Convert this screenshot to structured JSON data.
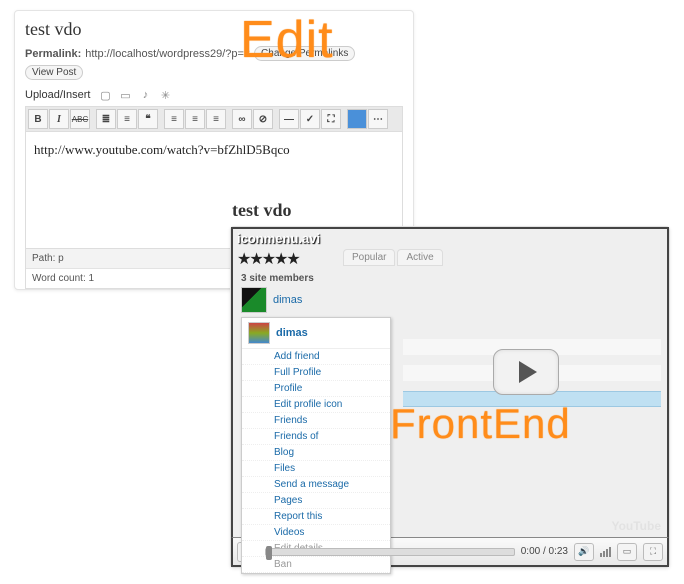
{
  "labels": {
    "edit": "Edit",
    "frontend": "FrontEnd"
  },
  "editor": {
    "title": "test vdo",
    "permalink_label": "Permalink:",
    "permalink_url": "http://localhost/wordpress29/?p=3",
    "change_btn": "Change Permalinks",
    "view_btn": "View Post",
    "upload_label": "Upload/Insert",
    "content": "http://www.youtube.com/watch?v=bfZhlD5Bqco",
    "path_label": "Path:",
    "path_value": "p",
    "wordcount_label": "Word count:",
    "wordcount_value": "1",
    "upload_icons": [
      "image-icon",
      "video-icon",
      "audio-icon",
      "star-icon"
    ],
    "toolbar": [
      "B",
      "I",
      "ABC",
      "ul",
      "ol",
      "quote",
      "|",
      "left",
      "center",
      "right",
      "|",
      "link",
      "unlink",
      "|",
      "more",
      "spell",
      "full",
      "|",
      "palette",
      "kitchen"
    ]
  },
  "frontend": {
    "title": "test vdo",
    "video_title": "iconmenu.avi",
    "tabs": [
      "Popular",
      "Active"
    ],
    "members_count_label": "3 site members",
    "member1": "dimas",
    "dropdown": {
      "name": "dimas",
      "items": [
        "Add friend",
        "Full Profile",
        "Profile",
        "Edit profile icon",
        "Friends",
        "Friends of",
        "Blog",
        "Files",
        "Send a message",
        "Pages",
        "Report this",
        "Videos",
        "Edit details",
        "Ban"
      ]
    },
    "youtube_logo": "YouTube",
    "time": "0:00 / 0:23"
  }
}
